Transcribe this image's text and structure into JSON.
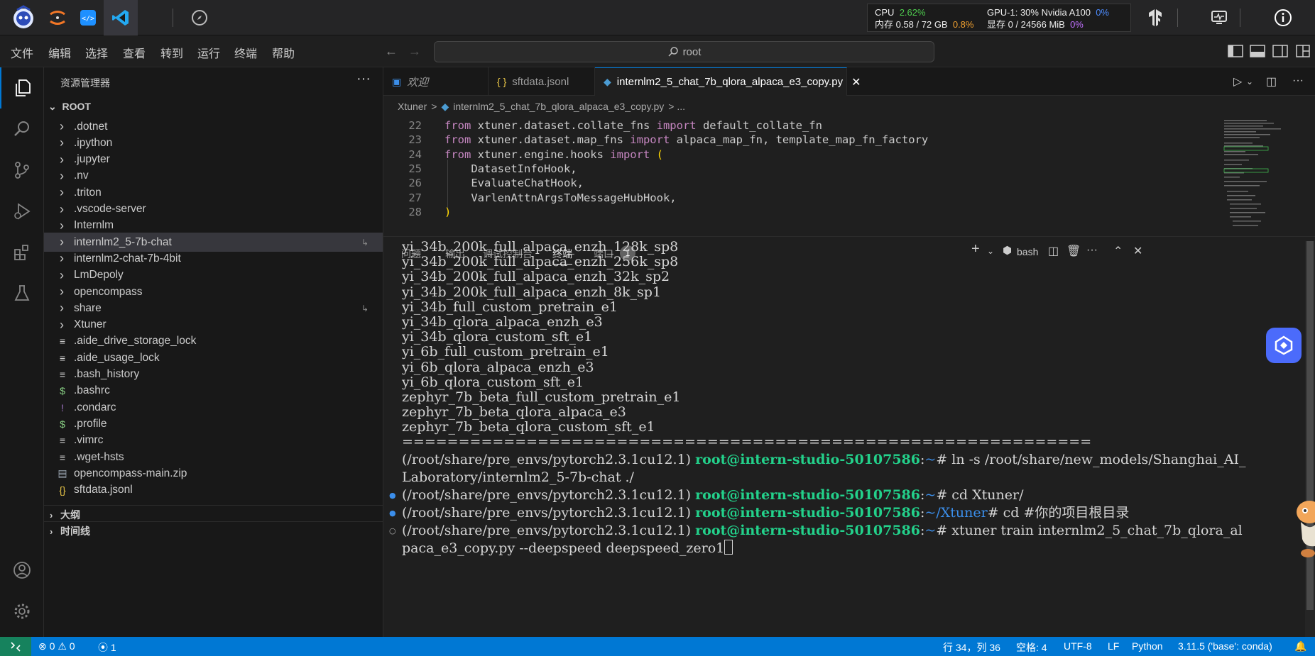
{
  "top_bar": {
    "apps": [
      "intern-logo-icon",
      "jupyter-icon",
      "code-editor-icon",
      "vscode-icon",
      "compass-icon"
    ],
    "system": {
      "cpu_label": "CPU",
      "cpu_value": "2.62%",
      "gpu_label": "GPU-1: 30% Nvidia A100",
      "gpu_value": "0%",
      "mem_label": "内存 0.58 / 72 GB",
      "mem_value": "0.8%",
      "vram_label": "显存 0 / 24566 MiB",
      "vram_value": "0%"
    }
  },
  "menu": [
    "文件",
    "编辑",
    "选择",
    "查看",
    "转到",
    "运行",
    "终端",
    "帮助"
  ],
  "command_center": {
    "text": "root"
  },
  "explorer": {
    "title": "资源管理器",
    "root": "ROOT",
    "items": [
      {
        "label": ".dotnet",
        "type": "folder"
      },
      {
        "label": ".ipython",
        "type": "folder"
      },
      {
        "label": ".jupyter",
        "type": "folder"
      },
      {
        "label": ".nv",
        "type": "folder"
      },
      {
        "label": ".triton",
        "type": "folder"
      },
      {
        "label": ".vscode-server",
        "type": "folder"
      },
      {
        "label": "Internlm",
        "type": "folder"
      },
      {
        "label": "internlm2_5-7b-chat",
        "type": "folder",
        "link": true,
        "selected": true
      },
      {
        "label": "internlm2-chat-7b-4bit",
        "type": "folder"
      },
      {
        "label": "LmDepoly",
        "type": "folder"
      },
      {
        "label": "opencompass",
        "type": "folder"
      },
      {
        "label": "share",
        "type": "folder",
        "link": true
      },
      {
        "label": "Xtuner",
        "type": "folder"
      },
      {
        "label": ".aide_drive_storage_lock",
        "type": "file"
      },
      {
        "label": ".aide_usage_lock",
        "type": "file"
      },
      {
        "label": ".bash_history",
        "type": "file"
      },
      {
        "label": ".bashrc",
        "type": "shell"
      },
      {
        "label": ".condarc",
        "type": "yaml"
      },
      {
        "label": ".profile",
        "type": "shell"
      },
      {
        "label": ".vimrc",
        "type": "file"
      },
      {
        "label": ".wget-hsts",
        "type": "file"
      },
      {
        "label": "opencompass-main.zip",
        "type": "zip"
      },
      {
        "label": "sftdata.jsonl",
        "type": "json"
      }
    ],
    "sections": [
      "大纲",
      "时间线"
    ]
  },
  "tabs": [
    {
      "label": "欢迎",
      "icon": "vscode-welcome-icon"
    },
    {
      "label": "sftdata.jsonl",
      "icon": "json-icon"
    },
    {
      "label": "internlm2_5_chat_7b_qlora_alpaca_e3_copy.py",
      "icon": "python-icon",
      "active": true
    }
  ],
  "breadcrumb": {
    "folder": "Xtuner",
    "sep": ">",
    "file": "internlm2_5_chat_7b_qlora_alpaca_e3_copy.py",
    "tail": "> ..."
  },
  "editor": {
    "lines": [
      {
        "num": "22",
        "text": "from xtuner.dataset.collate_fns import default_collate_fn"
      },
      {
        "num": "23",
        "text": "from xtuner.dataset.map_fns import alpaca_map_fn, template_map_fn_factory"
      },
      {
        "num": "24",
        "text": "from xtuner.engine.hooks import ("
      },
      {
        "num": "25",
        "text": "    DatasetInfoHook,"
      },
      {
        "num": "26",
        "text": "    EvaluateChatHook,"
      },
      {
        "num": "27",
        "text": "    VarlenAttnArgsToMessageHubHook,"
      },
      {
        "num": "28",
        "text": ")"
      }
    ]
  },
  "panel": {
    "tabs": [
      "问题",
      "输出",
      "调试控制台",
      "终端",
      "端口"
    ],
    "active_tab": "终端",
    "ports_count": "1",
    "shell_label": "bash"
  },
  "terminal": {
    "list": [
      "yi_34b_200k_full_alpaca_enzh_128k_sp8",
      "yi_34b_200k_full_alpaca_enzh_256k_sp8",
      "yi_34b_200k_full_alpaca_enzh_32k_sp2",
      "yi_34b_200k_full_alpaca_enzh_8k_sp1",
      "yi_34b_full_custom_pretrain_e1",
      "yi_34b_qlora_alpaca_enzh_e3",
      "yi_34b_qlora_custom_sft_e1",
      "yi_6b_full_custom_pretrain_e1",
      "yi_6b_qlora_alpaca_enzh_e3",
      "yi_6b_qlora_custom_sft_e1",
      "zephyr_7b_beta_full_custom_pretrain_e1",
      "zephyr_7b_beta_qlora_alpaca_e3",
      "zephyr_7b_beta_qlora_custom_sft_e1"
    ],
    "separator": "=============================================================",
    "env": "(/root/share/pre_envs/pytorch2.3.1cu12.1)",
    "user": "root@intern-studio-50107586",
    "cmd1_path": "~",
    "cmd1": "# ln -s /root/share/new_models/Shanghai_AI_",
    "cmd1_cont": "Laboratory/internlm2_5-7b-chat ./",
    "cmd2_path": "~",
    "cmd2": "# cd Xtuner/",
    "cmd3_path": "~/Xtuner",
    "cmd3": "# cd #你的项目根目录",
    "cmd4_path": "~",
    "cmd4": "# xtuner train internlm2_5_chat_7b_qlora_al",
    "cmd4_cont": "paca_e3_copy.py --deepspeed deepspeed_zero1"
  },
  "status": {
    "errors": "0",
    "warnings": "0",
    "ports": "1",
    "position": "行 34，列 36",
    "spaces": "空格: 4",
    "encoding": "UTF-8",
    "eol": "LF",
    "language": "Python",
    "interpreter": "3.11.5 ('base': conda)"
  }
}
